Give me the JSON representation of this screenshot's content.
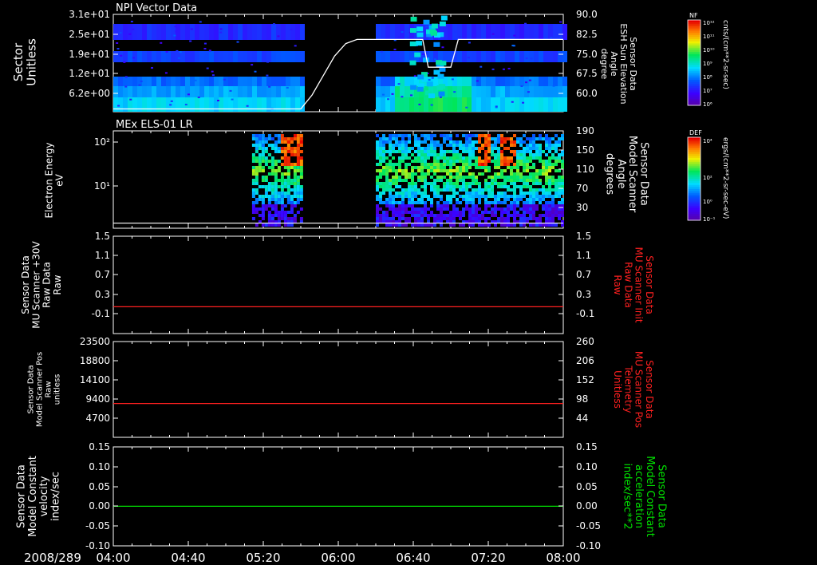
{
  "date_label": "2008/289",
  "time_ticks": [
    "04:00",
    "04:40",
    "05:20",
    "06:00",
    "06:40",
    "07:20",
    "08:00"
  ],
  "colors": {
    "background": "#000000",
    "axis": "#ffffff",
    "red_trace": "#ff2020",
    "green_trace": "#00e000",
    "right_label_red": "#ff2020",
    "right_label_green": "#00e000"
  },
  "colorbars": [
    {
      "title": "NF",
      "unit": "cnts/(cm**2-sr-sec)",
      "ticks": [
        "10¹²",
        "10¹¹",
        "10¹⁰",
        "10⁹",
        "10⁸",
        "10⁷",
        "10⁶"
      ]
    },
    {
      "title": "DEF",
      "unit": "ergs/(cm**2-sr-sec-eV)",
      "ticks": [
        "10⁴",
        "10²",
        "10⁰",
        "10⁻¹"
      ]
    }
  ],
  "chart_data": [
    {
      "type": "heatmap",
      "title": "NPI Vector Data",
      "ylabel": [
        "Sector",
        "Unitless"
      ],
      "yticks": [
        "3.1e+01",
        "2.5e+01",
        "1.9e+01",
        "1.2e+01",
        "6.2e+00"
      ],
      "right_ylabel": [
        "Sensor Data",
        "ESH Sun Elevation",
        "Angle",
        "degree"
      ],
      "right_yticks": [
        "90.0",
        "82.5",
        "75.0",
        "67.5",
        "60.0"
      ],
      "right_ylim": [
        55,
        90
      ],
      "data_gaps": [
        [
          "05:40",
          "06:20"
        ]
      ],
      "overlay_line": {
        "name": "ESH Sun Elevation Angle",
        "x": [
          "04:00",
          "05:40",
          "05:46",
          "05:52",
          "05:58",
          "06:04",
          "06:10",
          "06:20",
          "06:45",
          "06:48",
          "07:00",
          "07:04",
          "07:10",
          "08:00"
        ],
        "y": [
          56.0,
          56.0,
          61.0,
          68.0,
          75.0,
          79.5,
          81.0,
          81.0,
          81.0,
          71.0,
          71.0,
          81.0,
          81.0,
          81.0
        ]
      }
    },
    {
      "type": "heatmap",
      "title": "MEx ELS-01 LR",
      "ylabel": [
        "Electron Energy",
        "eV"
      ],
      "yticks": [
        "10²",
        "10¹"
      ],
      "right_ylabel": [
        "Sensor Data",
        "Model Scanner",
        "Angle",
        "degrees"
      ],
      "right_yticks": [
        "190",
        "150",
        "110",
        "70",
        "30"
      ],
      "right_ylim": [
        0,
        190
      ],
      "data_spans": [
        [
          "05:14",
          "05:40"
        ],
        [
          "06:20",
          "08:00"
        ]
      ],
      "overlay_line": {
        "name": "Model Scanner Angle",
        "x": [
          "04:00",
          "08:00"
        ],
        "y": [
          10,
          10
        ]
      }
    },
    {
      "type": "line",
      "ylabel": [
        "Sensor Data",
        "MU Scanner +30V",
        "Raw Data",
        "Raw"
      ],
      "yticks": [
        "1.5",
        "1.1",
        "0.7",
        "0.3",
        "-0.1"
      ],
      "right_ylabel": [
        "Sensor Data",
        "MU Scanner Init",
        "Raw Data",
        "Raw"
      ],
      "right_yticks": [
        "1.5",
        "1.1",
        "0.7",
        "0.3",
        "-0.1"
      ],
      "ylim": [
        -0.5,
        1.5
      ],
      "series": [
        {
          "x": [
            "04:00",
            "08:00"
          ],
          "y": [
            0.05,
            0.05
          ]
        }
      ]
    },
    {
      "type": "line",
      "ylabel": [
        "Sensor Data",
        "Model Scanner Pos",
        "Raw",
        "unitless"
      ],
      "yticks": [
        "23500",
        "18800",
        "14100",
        "9400",
        "4700"
      ],
      "right_ylabel": [
        "Sensor Data",
        "MU Scanner Pos",
        "Telemetry",
        "Unitless"
      ],
      "right_yticks": [
        "260",
        "206",
        "152",
        "98",
        "44"
      ],
      "ylim": [
        0,
        23500
      ],
      "series": [
        {
          "x": [
            "04:00",
            "08:00"
          ],
          "y": [
            8300,
            8300
          ]
        }
      ]
    },
    {
      "type": "line",
      "ylabel": [
        "Sensor Data",
        "Model Constant",
        "velocity",
        "index/sec"
      ],
      "yticks": [
        "0.15",
        "0.10",
        "0.05",
        "0.00",
        "-0.05",
        "-0.10"
      ],
      "right_ylabel": [
        "Sensor Data",
        "Model Constant",
        "acceleration",
        "index/sec**2"
      ],
      "right_yticks": [
        "0.15",
        "0.10",
        "0.05",
        "0.00",
        "-0.05",
        "-0.10"
      ],
      "ylim": [
        -0.1,
        0.15
      ],
      "series": [
        {
          "x": [
            "04:00",
            "08:00"
          ],
          "y": [
            0.0,
            0.0
          ]
        }
      ]
    }
  ]
}
